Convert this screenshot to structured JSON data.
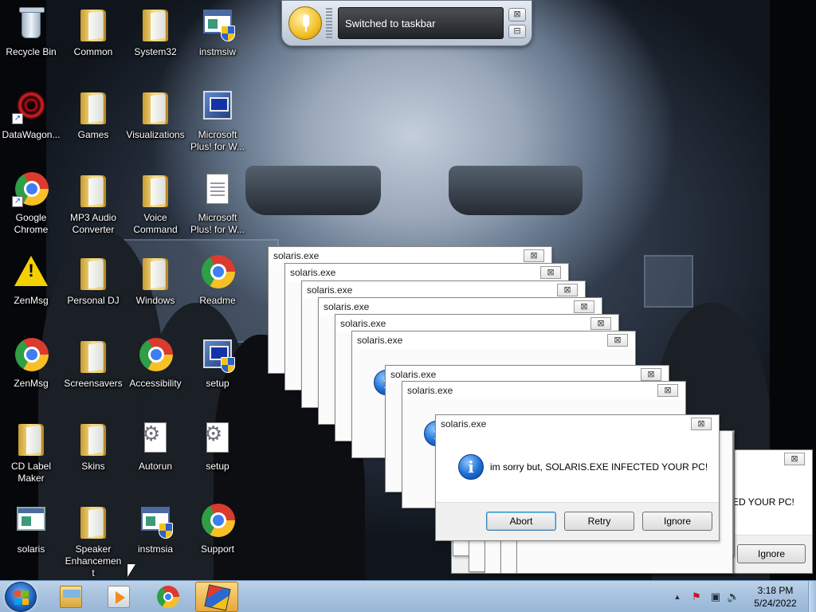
{
  "desktop": {
    "icons": [
      {
        "label": "Recycle Bin"
      },
      {
        "label": "DataWagon..."
      },
      {
        "label": "Google Chrome"
      },
      {
        "label": "ZenMsg"
      },
      {
        "label": "ZenMsg"
      },
      {
        "label": "CD Label Maker"
      },
      {
        "label": "solaris"
      },
      {
        "label": "Common"
      },
      {
        "label": "Games"
      },
      {
        "label": "MP3 Audio Converter"
      },
      {
        "label": "Personal DJ"
      },
      {
        "label": "Screensavers"
      },
      {
        "label": "Skins"
      },
      {
        "label": "Speaker Enhancement"
      },
      {
        "label": "System32"
      },
      {
        "label": "Visualizations"
      },
      {
        "label": "Voice Command"
      },
      {
        "label": "Windows"
      },
      {
        "label": "Accessibility"
      },
      {
        "label": "Autorun"
      },
      {
        "label": "instmsia"
      },
      {
        "label": "instmsiw"
      },
      {
        "label": "Microsoft Plus! for W..."
      },
      {
        "label": "Microsoft Plus! for W..."
      },
      {
        "label": "Readme"
      },
      {
        "label": "setup"
      },
      {
        "label": "setup"
      },
      {
        "label": "Support"
      }
    ]
  },
  "voice_bar": {
    "status": "Switched to taskbar",
    "close_glyph": "⊠",
    "minimize_glyph": "⊟"
  },
  "dialogs": {
    "title": "solaris.exe",
    "message": "im sorry but, SOLARIS.EXE INFECTED YOUR PC!",
    "message_partial": "CTED YOUR PC!",
    "buttons": {
      "abort": "Abort",
      "retry": "Retry",
      "ignore": "Ignore"
    },
    "close_glyph": "⊠",
    "info_glyph": "i"
  },
  "taskbar": {
    "time": "3:18 PM",
    "date": "5/24/2022",
    "tray": {
      "arrow": "▲",
      "flag": "⚑",
      "network": "▣",
      "volume": "🔈"
    }
  }
}
